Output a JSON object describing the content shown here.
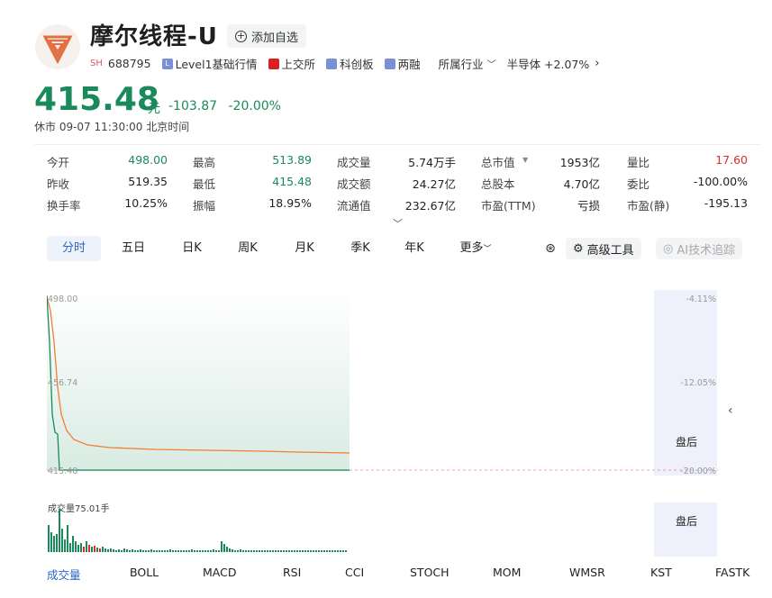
{
  "header": {
    "stock_name": "摩尔线程-U",
    "add_watch_label": "添加自选",
    "exchange_tag": "SH",
    "code": "688795",
    "tags": [
      "Level1基础行情",
      "上交所",
      "科创板",
      "两融"
    ],
    "industry_label": "所属行业",
    "industry_value": "半导体 +2.07%"
  },
  "price": {
    "last": "415.48",
    "unit": "元",
    "change": "-103.87",
    "change_pct": "-20.00%",
    "status": "休市 09-07 11:30:00 北京时间"
  },
  "quote": {
    "rows": [
      [
        [
          "今开",
          "498.00"
        ],
        [
          "最高",
          "513.89"
        ],
        [
          "成交量",
          "5.74万手"
        ],
        [
          "总市值",
          "1953亿"
        ],
        [
          "量比",
          "17.60"
        ]
      ],
      [
        [
          "昨收",
          "519.35"
        ],
        [
          "最低",
          "415.48"
        ],
        [
          "成交额",
          "24.27亿"
        ],
        [
          "总股本",
          "4.70亿"
        ],
        [
          "委比",
          "-100.00%"
        ]
      ],
      [
        [
          "换手率",
          "10.25%"
        ],
        [
          "振幅",
          "18.95%"
        ],
        [
          "流通值",
          "232.67亿"
        ],
        [
          "市盈(TTM)",
          "亏损"
        ],
        [
          "市盈(静)",
          "-195.13"
        ]
      ]
    ],
    "total_mv_marker": "▼",
    "expand_icon": "chevron-down-icon"
  },
  "tabs": {
    "items": [
      "分时",
      "五日",
      "日K",
      "周K",
      "月K",
      "季K",
      "年K",
      "更多"
    ],
    "active": "分时",
    "advanced_tools": "高级工具",
    "ai_tracking": "AI技术追踪"
  },
  "chart": {
    "y_left_ticks": [
      "498.00",
      "456.74",
      "415.48"
    ],
    "y_right_ticks": [
      "-4.11%",
      "-12.05%",
      "-20.00%"
    ],
    "after_hours_label": "盘后",
    "volume_label": "成交量75.01手",
    "colors": {
      "price_line": "#f08030",
      "area": "#d8ebe3",
      "green": "#1a8a5a",
      "red": "#d43030",
      "after_hours_bg": "#eef1fb"
    }
  },
  "indicator_tabs": {
    "items": [
      "成交量",
      "BOLL",
      "MACD",
      "RSI",
      "CCI",
      "STOCH",
      "MOM",
      "WMSR",
      "KST",
      "FASTK"
    ],
    "active": "成交量"
  }
}
